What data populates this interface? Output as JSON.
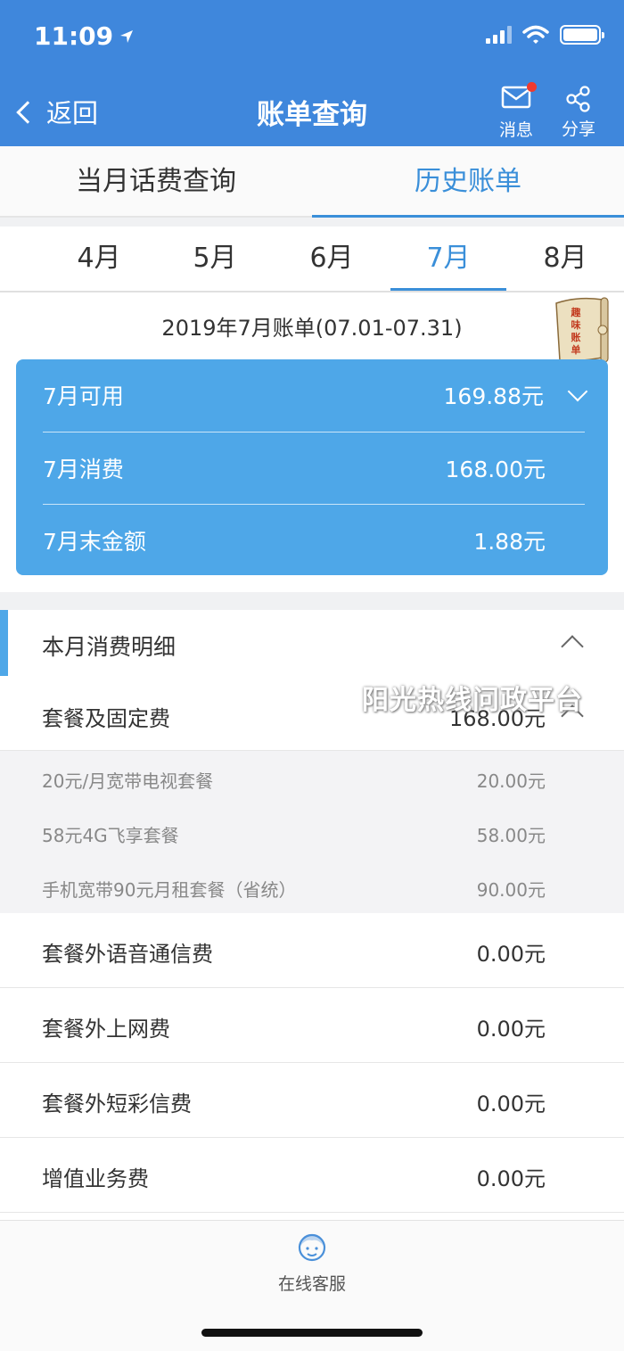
{
  "status_bar": {
    "time": "11:09"
  },
  "header": {
    "back_label": "返回",
    "title": "账单查询",
    "message_label": "消息",
    "share_label": "分享",
    "color": "#3f87dc"
  },
  "tabs": [
    {
      "label": "当月话费查询",
      "active": false
    },
    {
      "label": "历史账单",
      "active": true
    }
  ],
  "months": [
    {
      "label": "4月",
      "active": false
    },
    {
      "label": "5月",
      "active": false
    },
    {
      "label": "6月",
      "active": false
    },
    {
      "label": "7月",
      "active": true
    },
    {
      "label": "8月",
      "active": false
    }
  ],
  "period": "2019年7月账单(07.01-07.31)",
  "sticker_text": "趣味账单",
  "summary": [
    {
      "label": "7月可用",
      "value": "169.88元"
    },
    {
      "label": "7月消费",
      "value": "168.00元"
    },
    {
      "label": "7月末金额",
      "value": "1.88元"
    }
  ],
  "detail": {
    "title": "本月消费明细"
  },
  "watermark": "阳光热线问政平台",
  "package": {
    "label": "套餐及固定费",
    "value": "168.00元"
  },
  "package_items": [
    {
      "label": "20元/月宽带电视套餐",
      "value": "20.00元"
    },
    {
      "label": "58元4G飞享套餐",
      "value": "58.00元"
    },
    {
      "label": "手机宽带90元月租套餐（省统）",
      "value": "90.00元"
    }
  ],
  "fees": [
    {
      "label": "套餐外语音通信费",
      "value": "0.00元"
    },
    {
      "label": "套餐外上网费",
      "value": "0.00元"
    },
    {
      "label": "套餐外短彩信费",
      "value": "0.00元"
    },
    {
      "label": "增值业务费",
      "value": "0.00元"
    }
  ],
  "bottom": {
    "service_label": "在线客服"
  },
  "colors": {
    "accent": "#3a8fd9",
    "summary_bg": "#4ea7e8",
    "badge": "#f03a2e"
  }
}
